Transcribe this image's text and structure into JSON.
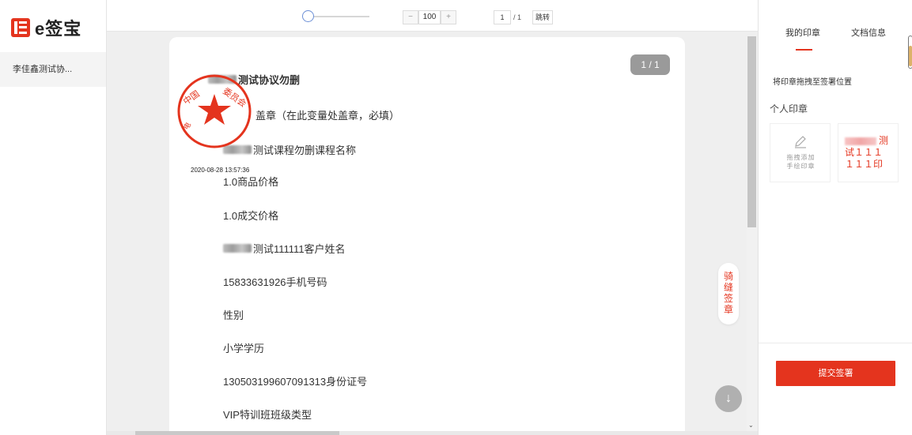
{
  "brand": {
    "name": "e签宝",
    "color": "#e4341e"
  },
  "sidebar": {
    "doc_item": "李佳鑫测试协..."
  },
  "toolbar": {
    "zoom_value": "100",
    "zoom_minus": "−",
    "zoom_plus": "+",
    "page_current": "1",
    "page_total": "/ 1",
    "jump_label": "跳转"
  },
  "document": {
    "page_badge": "1 / 1",
    "lines": [
      "测试协议勿删",
      "盖章（在此变量处盖章，必填）",
      "测试课程勿删课程名称",
      "1.0商品价格",
      "1.0成交价格",
      "测试111111客户姓名",
      "15833631926手机号码",
      "性别",
      "小学学历",
      "130503199607091313身份证号",
      "VIP特训班班级类型"
    ],
    "stamp_time": "2020-08-28 13:57:36",
    "riding_seal": [
      "骑",
      "缝",
      "签",
      "章"
    ]
  },
  "panel": {
    "tab_my_seal": "我的印章",
    "tab_doc_info": "文档信息",
    "hint": "将印章拖拽至签署位置",
    "section_title": "个人印章",
    "add_card_line1": "拖拽添加",
    "add_card_line2": "手绘印章",
    "seal_card_lines": [
      "测",
      "试１１１",
      "１１１印"
    ],
    "submit_label": "提交签署"
  }
}
